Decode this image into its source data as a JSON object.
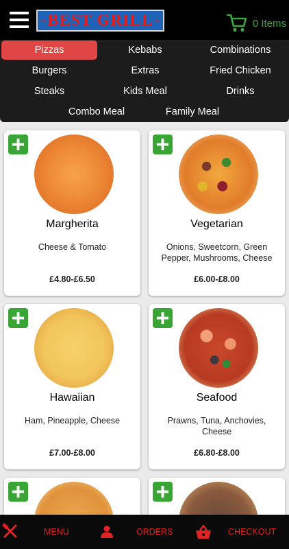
{
  "header": {
    "logo_text": "BEST GRILL",
    "logo_plus": "+",
    "cart_count_label": "0 Items"
  },
  "categories": [
    {
      "label": "Pizzas",
      "active": true
    },
    {
      "label": "Kebabs"
    },
    {
      "label": "Combinations"
    },
    {
      "label": "Burgers"
    },
    {
      "label": "Extras"
    },
    {
      "label": "Fried Chicken"
    },
    {
      "label": "Steaks"
    },
    {
      "label": "Kids Meal"
    },
    {
      "label": "Drinks"
    },
    {
      "label": "Combo Meal"
    },
    {
      "label": "Family Meal"
    }
  ],
  "products": [
    {
      "name": "Margherita",
      "description": "Cheese & Tomato",
      "price": "£4.80-£6.50"
    },
    {
      "name": "Vegetarian",
      "description": "Onions, Sweetcorn, Green Pepper, Mushrooms, Cheese",
      "price": "£6.00-£8.00"
    },
    {
      "name": "Hawaiian",
      "description": "Ham, Pineapple, Cheese",
      "price": "£7.00-£8.00"
    },
    {
      "name": "Seafood",
      "description": "Prawns, Tuna, Anchovies, Cheese",
      "price": "£6.80-£8.00"
    }
  ],
  "bottom_nav": {
    "menu_label": "MENU",
    "orders_label": "ORDERS",
    "checkout_label": "CHECKOUT"
  },
  "colors": {
    "header_bg": "#000000",
    "nav_bg": "#1c1c1c",
    "active_category": "#e04646",
    "add_button": "#38a534",
    "cart_green": "#3fa63f",
    "bottom_accent": "#e02424",
    "logo_blue": "#1f63b8"
  },
  "icons": {
    "menu": "hamburger-icon",
    "cart": "shopping-cart-icon",
    "add": "plus-icon",
    "bottom_menu": "fork-knife-icon",
    "bottom_orders": "user-icon",
    "bottom_checkout": "basket-icon"
  }
}
